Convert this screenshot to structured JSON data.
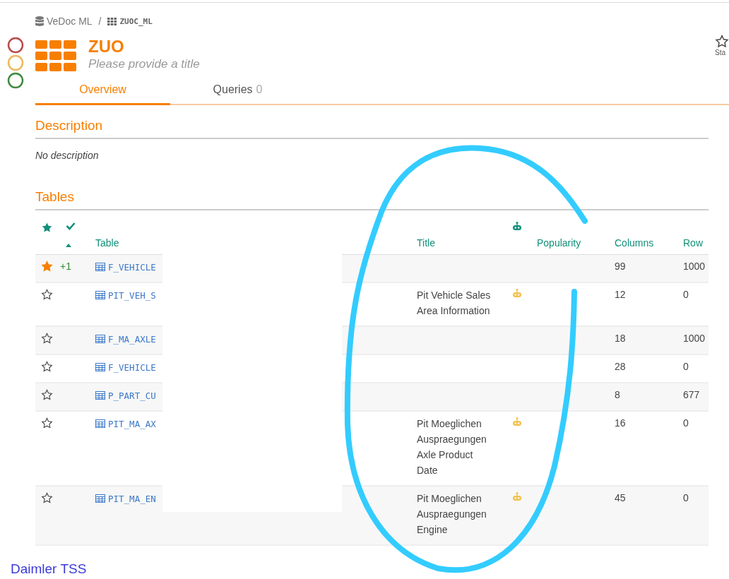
{
  "breadcrumb": [
    {
      "kind": "database",
      "label": "VeDoc ML"
    },
    {
      "kind": "schema",
      "label": "ZUOC_ML"
    }
  ],
  "breadcrumb_separator": "/",
  "status_lights": [
    {
      "color": "#b84a4a"
    },
    {
      "color": "#ecb95f"
    },
    {
      "color": "#3f8a3f"
    }
  ],
  "header": {
    "title": "ZUO",
    "subtitle": "Please provide a title",
    "star_label": "Sta"
  },
  "tabs": [
    {
      "label": "Overview",
      "selected": true
    },
    {
      "label": "Queries",
      "count": "0",
      "selected": false
    }
  ],
  "description": {
    "heading": "Description",
    "text": "No description"
  },
  "tables": {
    "heading": "Tables",
    "columns": [
      "Table",
      "Title",
      "Popularity",
      "Columns",
      "Row"
    ],
    "rows": [
      {
        "starred": true,
        "votes": "+1",
        "name": "F_VEHICLE",
        "robot": false,
        "columns": "99",
        "rows": "1000"
      },
      {
        "starred": false,
        "name": "PIT_VEH_S",
        "title": "Pit Vehicle Sales Area Information",
        "robot": true,
        "columns": "12",
        "rows": "0"
      },
      {
        "starred": false,
        "name": "F_MA_AXLE",
        "robot": false,
        "columns": "18",
        "rows": "1000"
      },
      {
        "starred": false,
        "name": "F_VEHICLE",
        "robot": false,
        "columns": "28",
        "rows": "0"
      },
      {
        "starred": false,
        "name": "P_PART_CU",
        "robot": false,
        "columns": "8",
        "rows": "677"
      },
      {
        "starred": false,
        "name": "PIT_MA_AX",
        "title": "Pit Moeglichen Auspraegungen Axle Product Date",
        "robot": true,
        "columns": "16",
        "rows": "0"
      },
      {
        "starred": false,
        "name": "PIT_MA_EN",
        "title": "Pit Moeglichen Auspraegungen Engine",
        "robot": true,
        "columns": "45",
        "rows": "0"
      }
    ]
  },
  "footer": "Daimler TSS"
}
